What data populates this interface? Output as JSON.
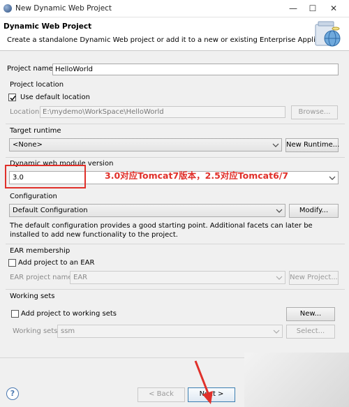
{
  "window": {
    "title": "New Dynamic Web Project"
  },
  "header": {
    "title": "Dynamic Web Project",
    "description": "Create a standalone Dynamic Web project or add it to a new or existing Enterprise Application."
  },
  "project_name": {
    "label": "Project name:",
    "value": "HelloWorld"
  },
  "location": {
    "group_label": "Project location",
    "use_default_label": "Use default location",
    "use_default_checked": true,
    "field_label": "Location:",
    "value": "E:\\mydemo\\WorkSpace\\HelloWorld",
    "browse_label": "Browse..."
  },
  "runtime": {
    "group_label": "Target runtime",
    "value": "<None>",
    "new_button": "New Runtime..."
  },
  "module": {
    "group_label": "Dynamic web module version",
    "value": "3.0"
  },
  "annotation": "3.0对应Tomcat7版本，2.5对应Tomcat6/7",
  "configuration": {
    "group_label": "Configuration",
    "value": "Default Configuration",
    "modify_button": "Modify...",
    "description": "The default configuration provides a good starting point. Additional facets can later be installed to add new functionality to the project."
  },
  "ear": {
    "group_label": "EAR membership",
    "add_label": "Add project to an EAR",
    "add_checked": false,
    "name_label": "EAR project name:",
    "name_value": "EAR",
    "new_project_button": "New Project..."
  },
  "working_sets": {
    "group_label": "Working sets",
    "add_label": "Add project to working sets",
    "add_checked": false,
    "new_button": "New...",
    "sets_label": "Working sets:",
    "sets_value": "ssm",
    "select_button": "Select..."
  },
  "footer": {
    "help": "?",
    "back": "< Back",
    "next": "Next >"
  }
}
